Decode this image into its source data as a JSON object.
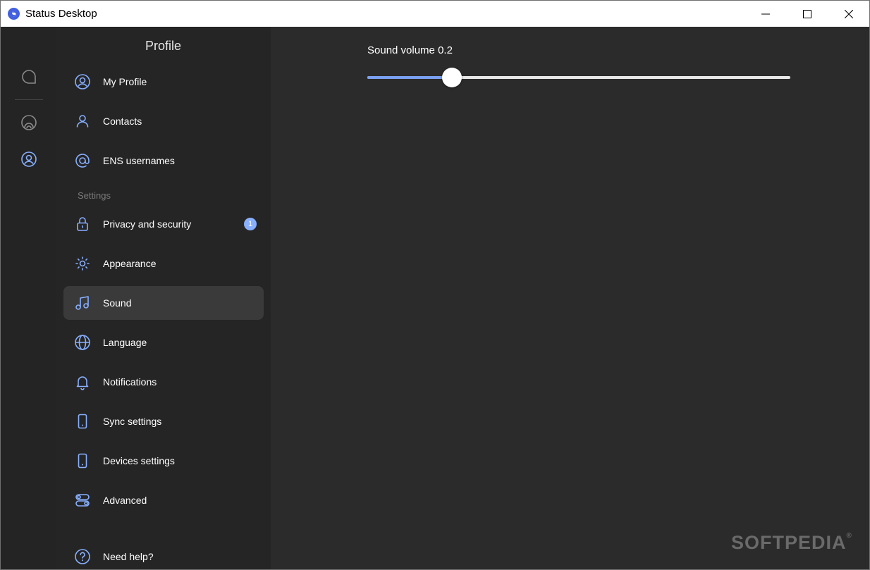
{
  "titlebar": {
    "title": "Status Desktop",
    "minimize_icon": "minimize-icon",
    "maximize_icon": "maximize-icon",
    "close_icon": "close-icon"
  },
  "rail": {
    "items": [
      {
        "name": "chat",
        "icon": "chat-bubble-icon"
      },
      {
        "name": "browser",
        "icon": "dapp-browser-icon"
      },
      {
        "name": "profile",
        "icon": "profile-icon",
        "accent": "#88b0ff"
      }
    ]
  },
  "sidebar": {
    "title": "Profile",
    "section_label": "Settings",
    "items": [
      {
        "label": "My Profile",
        "icon": "profile-circle-icon"
      },
      {
        "label": "Contacts",
        "icon": "contact-icon"
      },
      {
        "label": "ENS usernames",
        "icon": "at-sign-icon"
      },
      {
        "label": "Privacy and security",
        "icon": "lock-icon",
        "badge": "1"
      },
      {
        "label": "Appearance",
        "icon": "sun-icon"
      },
      {
        "label": "Sound",
        "icon": "music-note-icon",
        "active": true
      },
      {
        "label": "Language",
        "icon": "globe-icon"
      },
      {
        "label": "Notifications",
        "icon": "bell-icon"
      },
      {
        "label": "Sync settings",
        "icon": "mobile-sync-icon"
      },
      {
        "label": "Devices settings",
        "icon": "mobile-device-icon"
      },
      {
        "label": "Advanced",
        "icon": "toggles-icon"
      },
      {
        "label": "Need help?",
        "icon": "help-icon"
      }
    ]
  },
  "content": {
    "slider_label": "Sound volume 0.2",
    "volume": 0.2
  },
  "watermark": {
    "text": "SOFTPEDIA",
    "mark": "®"
  },
  "colors": {
    "accent": "#88b0ff",
    "brand": "#4360df",
    "slider_fill": "#7aa0f2"
  }
}
